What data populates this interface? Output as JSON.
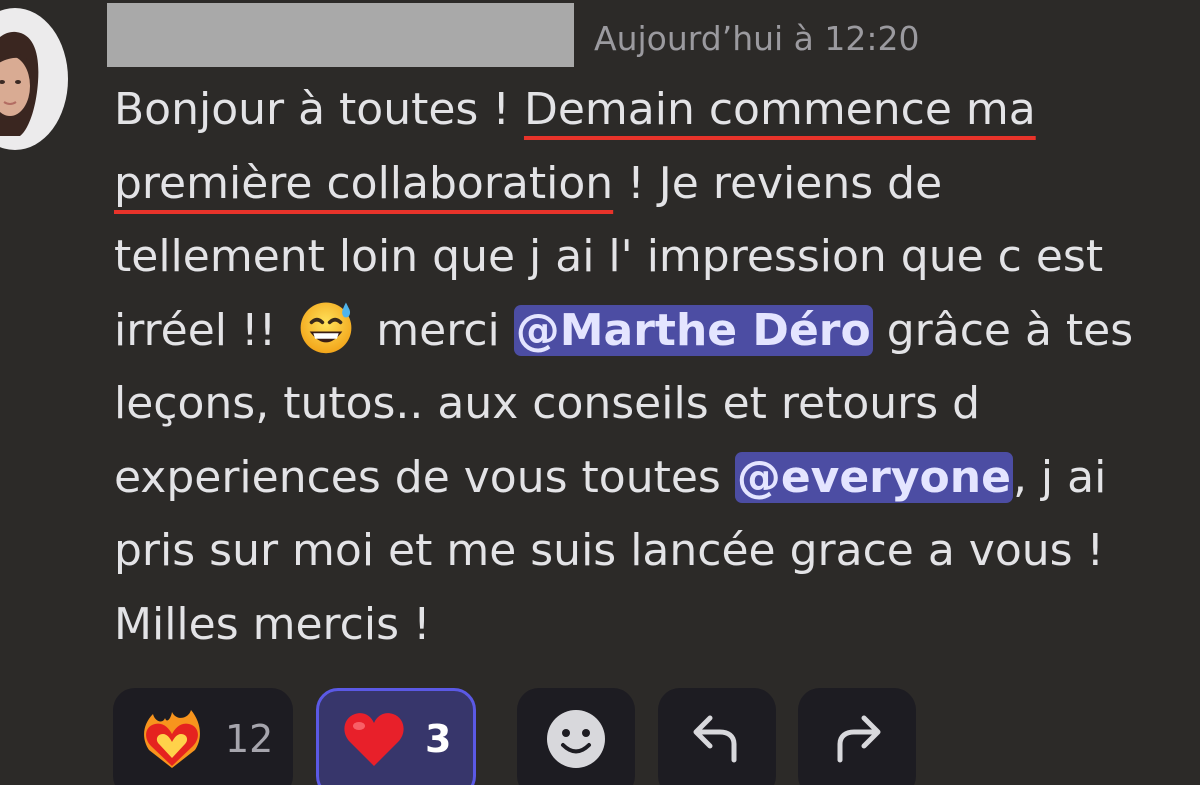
{
  "message": {
    "timestamp": "Aujourd’hui à 12:20",
    "lines": {
      "l1_a": "Bonjour à toutes ! ",
      "l1_b": "Demain commence ma",
      "l2_a": "première collaboration",
      "l2_b": " ! Je reviens de",
      "l3": "tellement loin que j ai l' impression que c est",
      "l4_a": "irréel !! ",
      "l4_b": " merci ",
      "l4_mention": "@Marthe Déro",
      "l4_c": " grâce à tes",
      "l5": "leçons, tutos.. aux conseils et retours d",
      "l6_a": "experiences de vous toutes ",
      "l6_mention": "@everyone",
      "l6_b": ", j ai",
      "l7": "pris sur moi et me suis lancée grace a vous !",
      "l8": "Milles mercis !"
    },
    "inline_emoji": "grinning-face-with-sweat",
    "highlight_color": "#e8332a"
  },
  "reactions": [
    {
      "emoji": "heart-on-fire",
      "count": "12",
      "selected": false
    },
    {
      "emoji": "red-heart",
      "count": "3",
      "selected": true
    }
  ],
  "actions": {
    "add_reaction_icon": "smiley-icon",
    "reply_icon": "reply-arrow-icon",
    "forward_icon": "forward-arrow-icon"
  },
  "colors": {
    "background": "#2c2a28",
    "mention_bg": "#4c4da3",
    "selected_reaction_border": "#5b59e5",
    "button_bg": "#1d1c22"
  }
}
